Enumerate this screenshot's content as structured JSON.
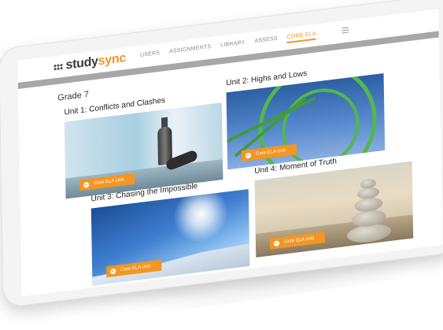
{
  "app": {
    "logo_part1": "study",
    "logo_part2": "sync",
    "logo_mark": "::"
  },
  "nav": {
    "items": [
      {
        "label": "USERS",
        "active": false
      },
      {
        "label": "ASSIGNMENTS",
        "active": false
      },
      {
        "label": "LIBRARY",
        "active": false
      },
      {
        "label": "ASSESS",
        "active": false
      },
      {
        "label": "CORE ELA",
        "active": true
      }
    ],
    "menu_icon": "hamburger-menu-icon"
  },
  "page": {
    "grade": "Grade 7"
  },
  "units": [
    {
      "title": "Unit 1: Conflicts and Clashes",
      "badge": "Core ELA Unit",
      "image": "chess-pieces"
    },
    {
      "title": "Unit 2: Highs and Lows",
      "badge": "Core ELA Unit",
      "image": "roller-coaster"
    },
    {
      "title": "Unit 3: Chasing the Impossible",
      "badge": "Core ELA Unit",
      "image": "sky-sun"
    },
    {
      "title": "Unit 4: Moment of Truth",
      "badge": "Core ELA Unit",
      "image": "stacked-stones"
    }
  ],
  "colors": {
    "accent": "#f29624",
    "nav_text": "#888888",
    "bar": "#a7a7a7"
  }
}
